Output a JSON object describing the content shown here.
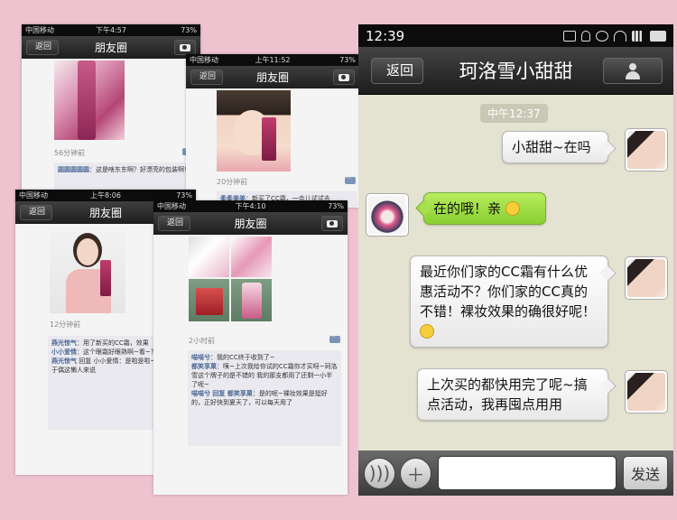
{
  "shared": {
    "carrier": "中国移动",
    "battery": "73%",
    "back_label": "返回",
    "moments_title": "朋友圈"
  },
  "phone1": {
    "time": "下午4:57",
    "ago": "56分钟前",
    "comment_name": "圆圆圆圆圆",
    "comment_text": "：这是啥东东啊？好漂亮的包装啊！"
  },
  "phone2": {
    "time": "上午11:52",
    "ago": "20分钟前",
    "comment_name": "柔柔美美",
    "comment_text": "：新买了CC霜，一会儿试试去"
  },
  "phone3": {
    "time": "上午8:06",
    "ago": "12分钟前",
    "comments": [
      {
        "name": "燕光惊气",
        "text": "：用了新买的CC霜，效果"
      },
      {
        "name": "小小爱情",
        "text": "：这个眼霜好眼熟啊~看~？"
      },
      {
        "name": "燕光惊气",
        "text": " 回复 小小爱情：是啦是啦~你用过？对于偶这懒人来说"
      }
    ]
  },
  "phone4": {
    "time": "下午4:10",
    "ago": "2小时前",
    "comments": [
      {
        "name": "喵喵兮",
        "text": "：我的CC终于收到了~"
      },
      {
        "name": "都笑享菓",
        "text": "：咦~上次我给你试的CC霜你才买呀~珂洛雪这个牌子的是不错的 我的那支都用了还剩一小半了呢~"
      },
      {
        "name": "喵喵兮 回复 都笑享菓",
        "text": "：是的呢~裸妆效果是挺好的，正好快到夏天了，可以每天用了"
      }
    ]
  },
  "chat": {
    "status_time": "12:39",
    "title": "珂洛雪小甜甜",
    "back_label": "返回",
    "timestamp": "中午12:37",
    "messages": [
      {
        "side": "right",
        "text": "小甜甜~在吗"
      },
      {
        "side": "left",
        "text": "在的哦！亲"
      },
      {
        "side": "right",
        "text": "最近你们家的CC霜有什么优惠活动不？你们家的CC真的不错！裸妆效果的确很好呢！"
      },
      {
        "side": "right",
        "text": "上次买的都快用完了呢~搞点活动，我再囤点用用"
      }
    ],
    "send_label": "发送",
    "voice_icon": "voice-icon",
    "plus_icon": "plus-icon"
  },
  "colors": {
    "background": "#eec2cf",
    "chat_bg": "#e4e2d0",
    "green_bubble": "#9edc43",
    "link_name": "#4e6a98"
  }
}
